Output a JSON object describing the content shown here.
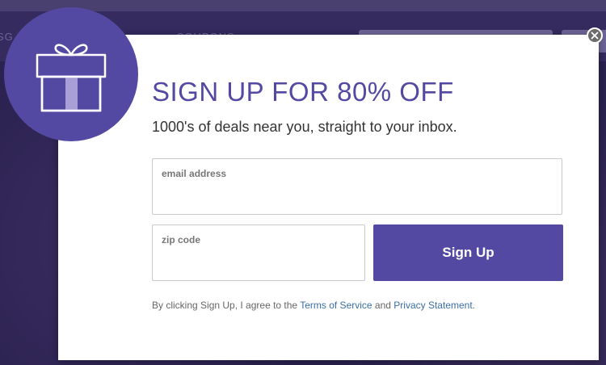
{
  "background": {
    "nav_items": [
      "SG",
      "COUPONS"
    ],
    "search_placeholder": "search",
    "nav_button_label": "ne"
  },
  "modal": {
    "title": "SIGN UP FOR 80% OFF",
    "subtitle": "1000's of deals near you, straight to your inbox.",
    "email_label": "email address",
    "email_value": "",
    "zip_label": "zip code",
    "zip_value": "",
    "signup_label": "Sign Up",
    "disclaimer_prefix": "By clicking Sign Up, I agree to the ",
    "terms_link": "Terms of Service",
    "disclaimer_and": " and ",
    "privacy_link": "Privacy Statement",
    "disclaimer_suffix": ".",
    "icons": {
      "badge": "gift-icon",
      "close": "close-icon"
    }
  },
  "colors": {
    "brand": "#5449a2",
    "link": "#3a6ea8",
    "overlay": "#2c2352"
  }
}
